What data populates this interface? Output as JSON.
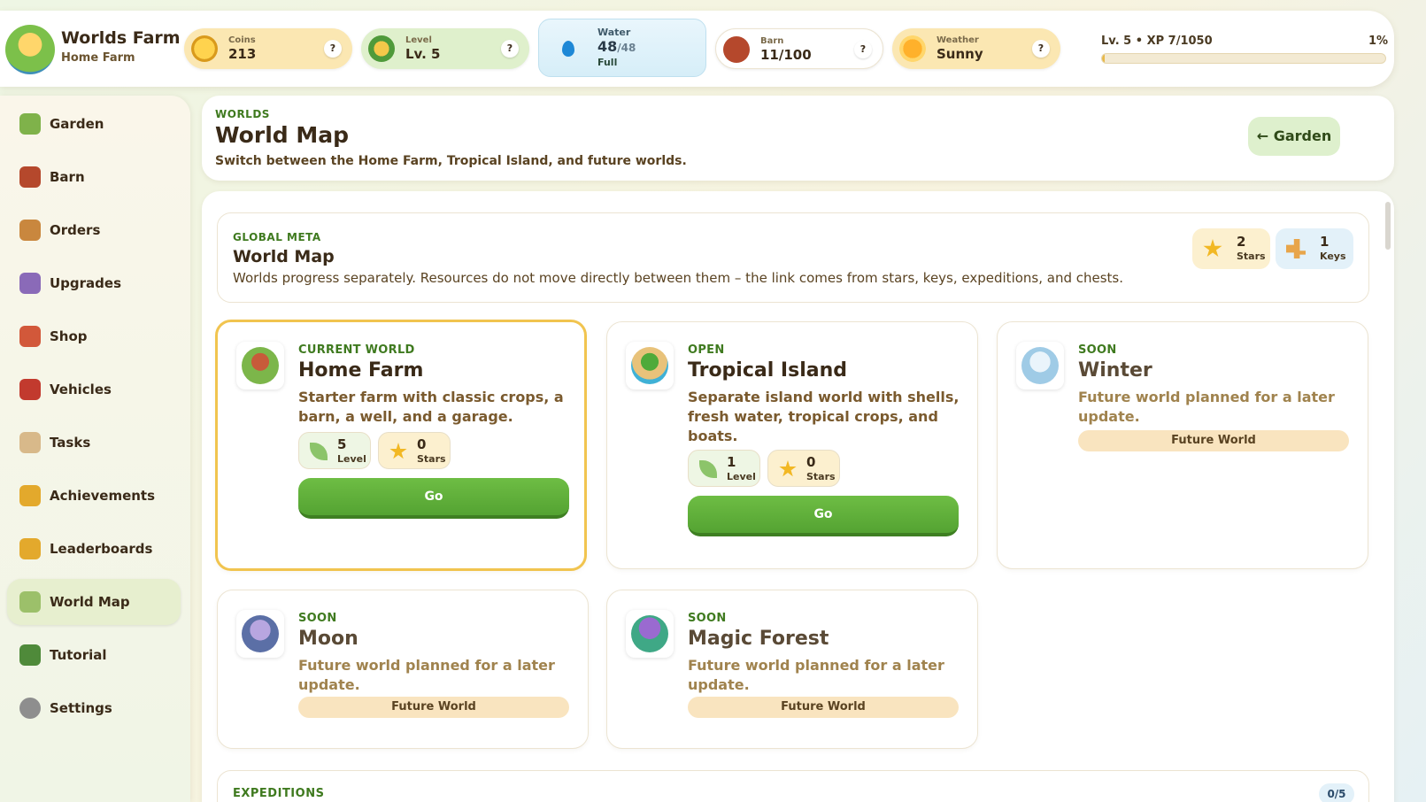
{
  "app": {
    "title": "Worlds Farm",
    "subtitle": "Home Farm"
  },
  "stats": {
    "coins": {
      "label": "Coins",
      "value": "213",
      "help": "?"
    },
    "level": {
      "label": "Level",
      "value": "Lv. 5",
      "help": "?"
    },
    "water": {
      "label": "Water",
      "value": "48",
      "max": "/48",
      "status": "Full"
    },
    "barn": {
      "label": "Barn",
      "value": "11/100",
      "help": "?"
    },
    "weather": {
      "label": "Weather",
      "value": "Sunny",
      "help": "?"
    }
  },
  "xp": {
    "text": "Lv. 5 • XP 7/1050",
    "percent_label": "1%",
    "progress_fraction": 0.01
  },
  "sidebar": {
    "items": [
      {
        "label": "Garden",
        "active": false
      },
      {
        "label": "Barn",
        "active": false
      },
      {
        "label": "Orders",
        "active": false
      },
      {
        "label": "Upgrades",
        "active": false
      },
      {
        "label": "Shop",
        "active": false
      },
      {
        "label": "Vehicles",
        "active": false
      },
      {
        "label": "Tasks",
        "active": false
      },
      {
        "label": "Achievements",
        "active": false
      },
      {
        "label": "Leaderboards",
        "active": false
      },
      {
        "label": "World Map",
        "active": true
      },
      {
        "label": "Tutorial",
        "active": false
      },
      {
        "label": "Settings",
        "active": false
      }
    ]
  },
  "header": {
    "eyebrow": "WORLDS",
    "title": "World Map",
    "description": "Switch between the Home Farm, Tropical Island, and future worlds.",
    "back_label": "← Garden"
  },
  "meta": {
    "eyebrow": "GLOBAL META",
    "title": "World Map",
    "description": "Worlds progress separately. Resources do not move directly between them – the link comes from stars, keys, expeditions, and chests.",
    "stars": {
      "value": "2",
      "label": "Stars"
    },
    "keys": {
      "value": "1",
      "label": "Keys"
    }
  },
  "worlds": [
    {
      "status": "CURRENT WORLD",
      "title": "Home Farm",
      "description": "Starter farm with classic crops, a barn, a well, and a garage.",
      "level": "5",
      "level_label": "Level",
      "stars": "0",
      "stars_label": "Stars",
      "action": "Go"
    },
    {
      "status": "OPEN",
      "title": "Tropical Island",
      "description": "Separate island world with shells, fresh water, tropical crops, and boats.",
      "level": "1",
      "level_label": "Level",
      "stars": "0",
      "stars_label": "Stars",
      "action": "Go"
    },
    {
      "status": "SOON",
      "title": "Winter",
      "description": "Future world planned for a later update.",
      "pill": "Future World"
    },
    {
      "status": "SOON",
      "title": "Moon",
      "description": "Future world planned for a later update.",
      "pill": "Future World"
    },
    {
      "status": "SOON",
      "title": "Magic Forest",
      "description": "Future world planned for a later update.",
      "pill": "Future World"
    }
  ],
  "expeditions": {
    "label": "EXPEDITIONS",
    "count": "0/5"
  },
  "colors": {
    "accent_green": "#54a332",
    "current_border": "#f1c44f",
    "eyebrow_green": "#3f7a1f"
  }
}
